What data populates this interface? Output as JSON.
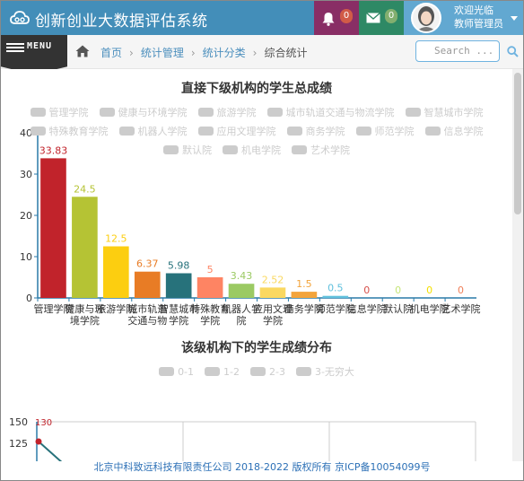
{
  "header": {
    "app_title": "创新创业大数据评估系统",
    "notifications_count": "0",
    "messages_count": "0",
    "welcome_line1": "欢迎光临",
    "welcome_line2": "教师管理员",
    "accent_color": "#438eb9"
  },
  "breadcrumb": {
    "menu_label": "MENU",
    "items": [
      "首页",
      "统计管理",
      "统计分类",
      "综合统计"
    ],
    "search_placeholder": "Search ..."
  },
  "chart1_title": "直接下级机构的学生总成绩",
  "chart2_title": "该级机构下的学生成绩分布",
  "chart_data": [
    {
      "type": "bar",
      "title": "直接下级机构的学生总成绩",
      "legend_placement": "top",
      "legend_state": "all-disabled",
      "categories": [
        "管理学院",
        "健康与环境学院",
        "旅游学院",
        "城市轨道交通与物流学院",
        "智慧城市学院",
        "特殊教育学院",
        "机器人学院",
        "应用文理学院",
        "商务学院",
        "师范学院",
        "信息学院",
        "默认院",
        "机电学院",
        "艺术学院"
      ],
      "values": [
        33.83,
        24.5,
        12.5,
        6.37,
        5.98,
        5,
        3.43,
        2.52,
        1.5,
        0.5,
        0,
        0,
        0,
        0
      ],
      "colors": [
        "#c1232b",
        "#b5c334",
        "#fcce10",
        "#e87c25",
        "#27727b",
        "#fe8463",
        "#9bca63",
        "#fad860",
        "#f3a43b",
        "#60c0dd",
        "#d7504b",
        "#c6e579",
        "#f4e001",
        "#f0805a"
      ],
      "ylim": [
        0,
        40
      ],
      "yticks": [
        0,
        10,
        20,
        30,
        40
      ],
      "xlabel": "",
      "ylabel": "",
      "grid": false
    },
    {
      "type": "line",
      "title": "该级机构下的学生成绩分布",
      "legend_placement": "top",
      "series": [
        {
          "name": "0-1"
        },
        {
          "name": "1-2"
        },
        {
          "name": "2-3"
        },
        {
          "name": "3-无穷大"
        }
      ],
      "yticks": [
        125,
        150
      ],
      "visible_value_label": "130",
      "first_point_y": 125,
      "grid": true
    }
  ],
  "footer": {
    "text": "北京中科致远科技有限责任公司 2018-2022 版权所有 京ICP备10054099号"
  }
}
